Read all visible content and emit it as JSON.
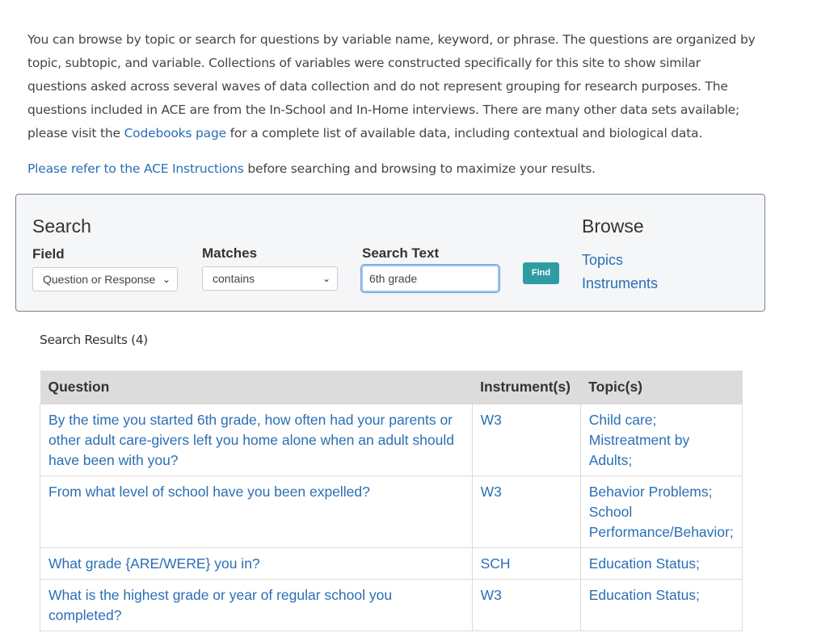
{
  "intro": {
    "text_before_link": "You can browse by topic or search for questions by variable name, keyword, or phrase. The questions are organized by topic, subtopic, and variable. Collections of variables were constructed specifically for this site to show similar questions asked across several waves of data collection and do not represent grouping for research purposes. The questions included in ACE are from the In-School and In-Home interviews. There are many other data sets available; please visit the ",
    "link_text": "Codebooks page",
    "text_after_link": " for a complete list of available data, including contextual and biological data."
  },
  "refer": {
    "link_text": "Please refer to the ACE Instructions",
    "text_after": " before searching and browsing to maximize your results."
  },
  "search": {
    "title": "Search",
    "field_label": "Field",
    "field_value": "Question or Response",
    "matches_label": "Matches",
    "matches_value": "contains",
    "text_label": "Search Text",
    "text_value": "6th grade",
    "find_label": "Find"
  },
  "browse": {
    "title": "Browse",
    "links": [
      "Topics",
      "Instruments"
    ]
  },
  "results": {
    "count_label": "Search Results (4)",
    "headers": [
      "Question",
      "Instrument(s)",
      "Topic(s)"
    ],
    "rows": [
      {
        "question": "By the time you started 6th grade, how often had your parents or other adult care-givers left you home alone when an adult should have been with you?",
        "instrument": "W3",
        "topic": "Child care; Mistreatment by Adults;"
      },
      {
        "question": "From what level of school have you been expelled?",
        "instrument": "W3",
        "topic": "Behavior Problems; School Performance/Behavior;"
      },
      {
        "question": "What grade {ARE/WERE} you in?",
        "instrument": "SCH",
        "topic": "Education Status;"
      },
      {
        "question": "What is the highest grade or year of regular school you completed?",
        "instrument": "W3",
        "topic": "Education Status;"
      }
    ]
  },
  "icons": {
    "chevron": "chevron-down-icon"
  },
  "colors": {
    "link": "#2a6fb5",
    "find_button": "#2f9ca3",
    "panel_bg": "#f5f6f8",
    "table_header": "#dcdcdc"
  }
}
